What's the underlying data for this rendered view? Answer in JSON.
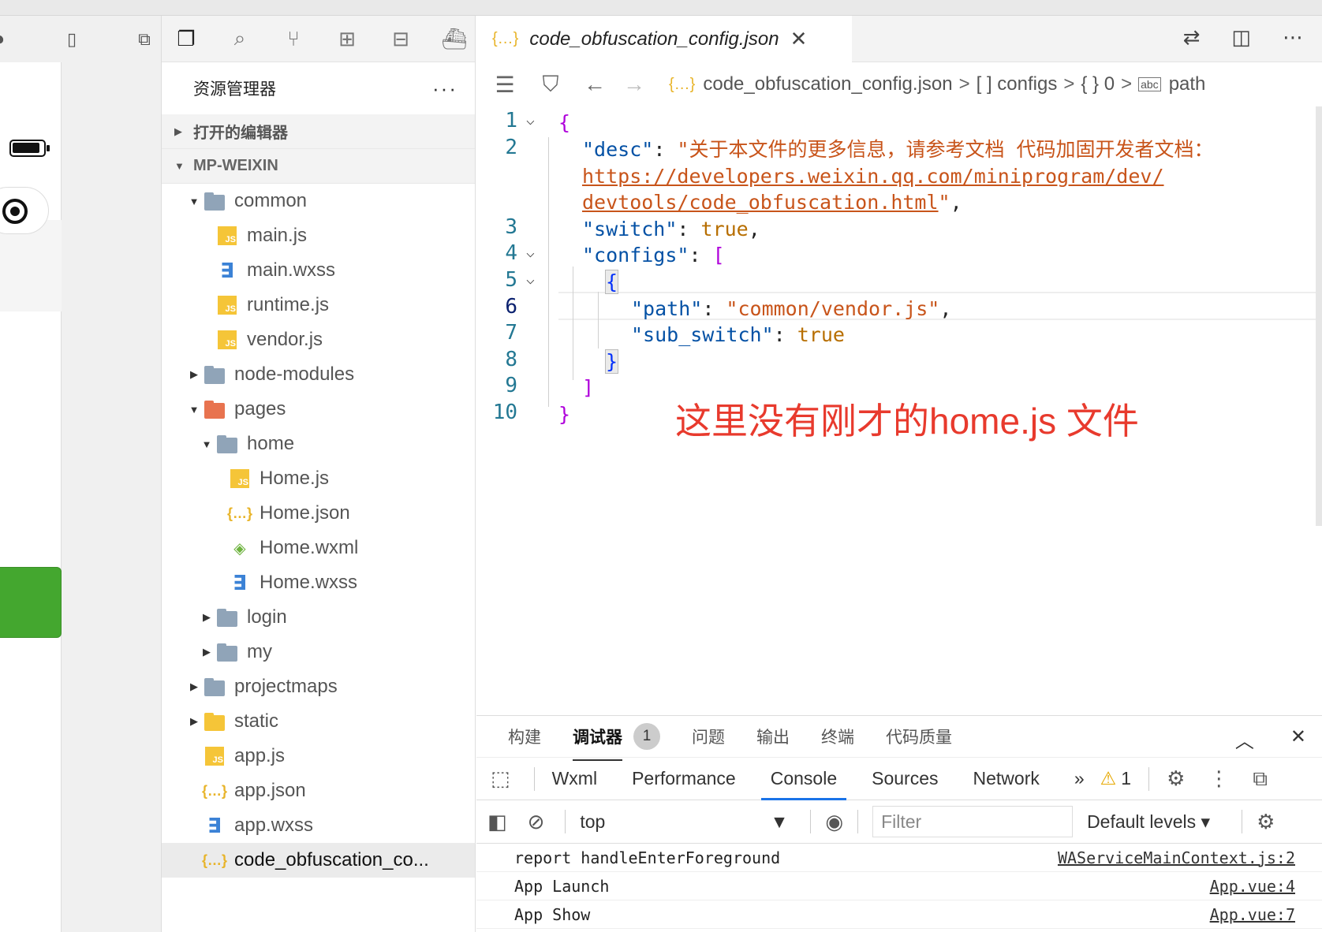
{
  "explorer": {
    "title": "资源管理器",
    "more": "···",
    "open_editors": "打开的编辑器",
    "project": "MP-WEIXIN",
    "tree": [
      {
        "label": "common",
        "depth": 1,
        "type": "folder-open",
        "twisty": "▼"
      },
      {
        "label": "main.js",
        "depth": 2,
        "type": "js",
        "twisty": ""
      },
      {
        "label": "main.wxss",
        "depth": 2,
        "type": "css",
        "twisty": ""
      },
      {
        "label": "runtime.js",
        "depth": 2,
        "type": "js",
        "twisty": ""
      },
      {
        "label": "vendor.js",
        "depth": 2,
        "type": "js",
        "twisty": ""
      },
      {
        "label": "node-modules",
        "depth": 1,
        "type": "folder",
        "twisty": "▶"
      },
      {
        "label": "pages",
        "depth": 1,
        "type": "folder pages",
        "twisty": "▼"
      },
      {
        "label": "home",
        "depth": 2,
        "type": "folder-open",
        "twisty": "▼"
      },
      {
        "label": "Home.js",
        "depth": 3,
        "type": "js",
        "twisty": ""
      },
      {
        "label": "Home.json",
        "depth": 3,
        "type": "json",
        "twisty": ""
      },
      {
        "label": "Home.wxml",
        "depth": 3,
        "type": "wxml",
        "twisty": ""
      },
      {
        "label": "Home.wxss",
        "depth": 3,
        "type": "css",
        "twisty": ""
      },
      {
        "label": "login",
        "depth": 2,
        "type": "folder",
        "twisty": "▶"
      },
      {
        "label": "my",
        "depth": 2,
        "type": "folder",
        "twisty": "▶"
      },
      {
        "label": "projectmaps",
        "depth": 1,
        "type": "folder",
        "twisty": "▶"
      },
      {
        "label": "static",
        "depth": 1,
        "type": "folder static",
        "twisty": "▶"
      },
      {
        "label": "app.js",
        "depth": 1,
        "type": "js",
        "twisty": ""
      },
      {
        "label": "app.json",
        "depth": 1,
        "type": "json",
        "twisty": ""
      },
      {
        "label": "app.wxss",
        "depth": 1,
        "type": "css",
        "twisty": ""
      },
      {
        "label": "code_obfuscation_co...",
        "depth": 1,
        "type": "json",
        "twisty": "",
        "selected": true
      }
    ]
  },
  "editor": {
    "tab_title": "code_obfuscation_config.json",
    "tab_icon": "{…}",
    "tab_close": "✕",
    "breadcrumb": {
      "file": "code_obfuscation_config.json",
      "b1": "[ ]",
      "b1_label": "configs",
      "b2": "{ }",
      "b2_label": "0",
      "b3_label": "path"
    },
    "line_numbers": [
      "1",
      "2",
      "3",
      "4",
      "5",
      "6",
      "7",
      "8",
      "9",
      "10"
    ],
    "code": {
      "desc_key": "\"desc\"",
      "desc_text": "\"关于本文件的更多信息，请参考文档 代码加固开发者文档：",
      "url1": "https://developers.weixin.qq.com/miniprogram/dev/",
      "url2": "devtools/code_obfuscation.html",
      "switch_key": "\"switch\"",
      "true": "true",
      "configs_key": "\"configs\"",
      "path_key": "\"path\"",
      "path_val": "\"common/vendor.js\"",
      "sub_key": "\"sub_switch\""
    },
    "annotation": "这里没有刚才的home.js 文件"
  },
  "panel": {
    "tabs": [
      "构建",
      "调试器",
      "问题",
      "输出",
      "终端",
      "代码质量"
    ],
    "debugger_badge": "1",
    "devtools_tabs": [
      "Wxml",
      "Performance",
      "Console",
      "Sources",
      "Network"
    ],
    "more_tabs": "»",
    "warning_count": "1",
    "context": "top",
    "filter_placeholder": "Filter",
    "levels": "Default levels ▾",
    "logs": [
      {
        "msg": "report handleEnterForeground",
        "src": "WAServiceMainContext.js:2"
      },
      {
        "msg": "App Launch",
        "src": "App.vue:4"
      },
      {
        "msg": "App Show",
        "src": "App.vue:7"
      }
    ]
  }
}
